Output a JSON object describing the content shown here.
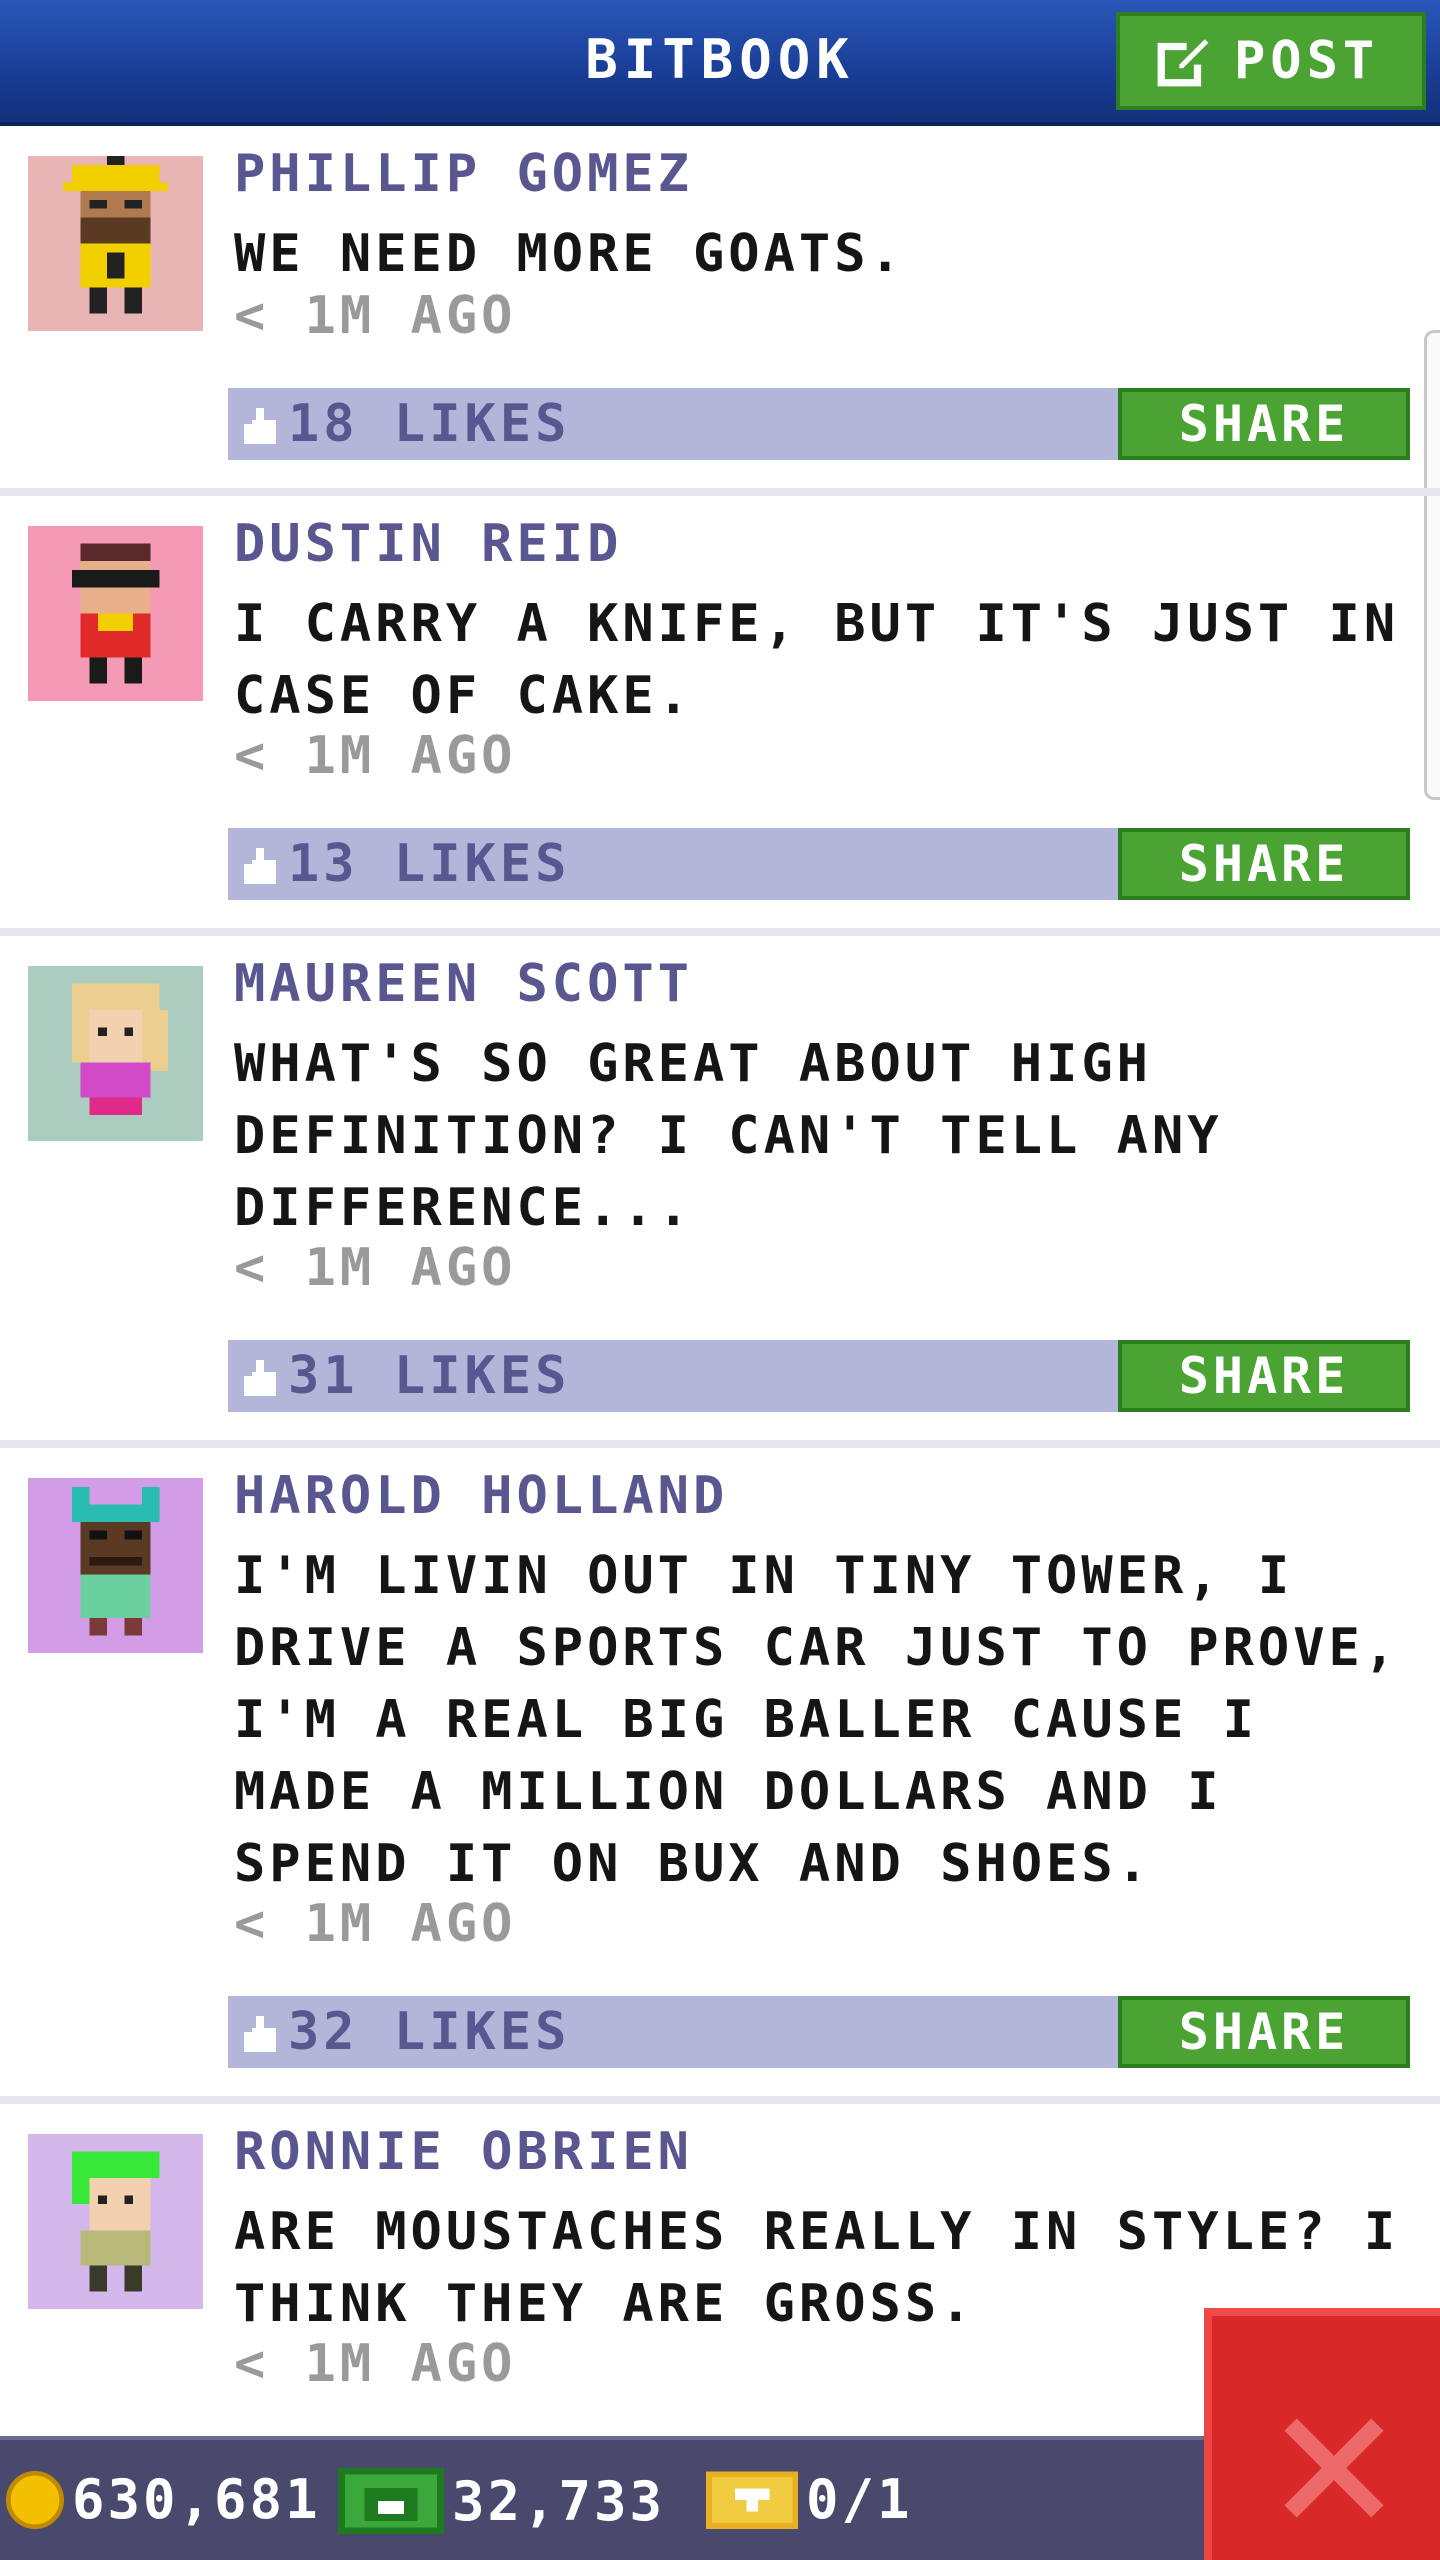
{
  "header": {
    "title": "BITBOOK",
    "post_label": "POST"
  },
  "posts": [
    {
      "name": "PHILLIP GOMEZ",
      "message": "WE NEED MORE GOATS.",
      "time": "< 1M AGO",
      "likes": "18 LIKES",
      "share": "SHARE",
      "avatar_bg": "#e8b4b4"
    },
    {
      "name": "DUSTIN REID",
      "message": "I CARRY A KNIFE, BUT IT'S JUST IN CASE OF CAKE.",
      "time": "< 1M AGO",
      "likes": "13 LIKES",
      "share": "SHARE",
      "avatar_bg": "#f49ab6"
    },
    {
      "name": "MAUREEN SCOTT",
      "message": "WHAT'S SO GREAT ABOUT HIGH DEFINITION? I CAN'T TELL ANY DIFFERENCE...",
      "time": "< 1M AGO",
      "likes": "31 LIKES",
      "share": "SHARE",
      "avatar_bg": "#acccc0"
    },
    {
      "name": "HAROLD HOLLAND",
      "message": "I'M LIVIN OUT IN TINY TOWER, I DRIVE A SPORTS CAR JUST TO PROVE, I'M A REAL BIG BALLER CAUSE I MADE A MILLION DOLLARS AND I SPEND IT ON BUX AND SHOES.",
      "time": "< 1M AGO",
      "likes": "32 LIKES",
      "share": "SHARE",
      "avatar_bg": "#d29ce6"
    },
    {
      "name": "RONNIE OBRIEN",
      "message": "ARE MOUSTACHES REALLY IN STYLE? I THINK THEY ARE GROSS.",
      "time": "< 1M AGO",
      "avatar_bg": "#d4b8ec"
    }
  ],
  "currency": {
    "coins": "630,681",
    "bux": "32,733",
    "tickets": "0/1"
  },
  "colors": {
    "header": "#1a3f98",
    "accent_green": "#4ba334",
    "name_purple": "#5a5690",
    "likes_bar": "#b3b6d8",
    "close_red": "#d82828"
  },
  "icons": {
    "post": "edit-icon",
    "like": "thumbs-up-icon",
    "coin": "coin-icon",
    "bux": "bux-icon",
    "ticket": "ticket-icon",
    "close": "close-icon"
  }
}
